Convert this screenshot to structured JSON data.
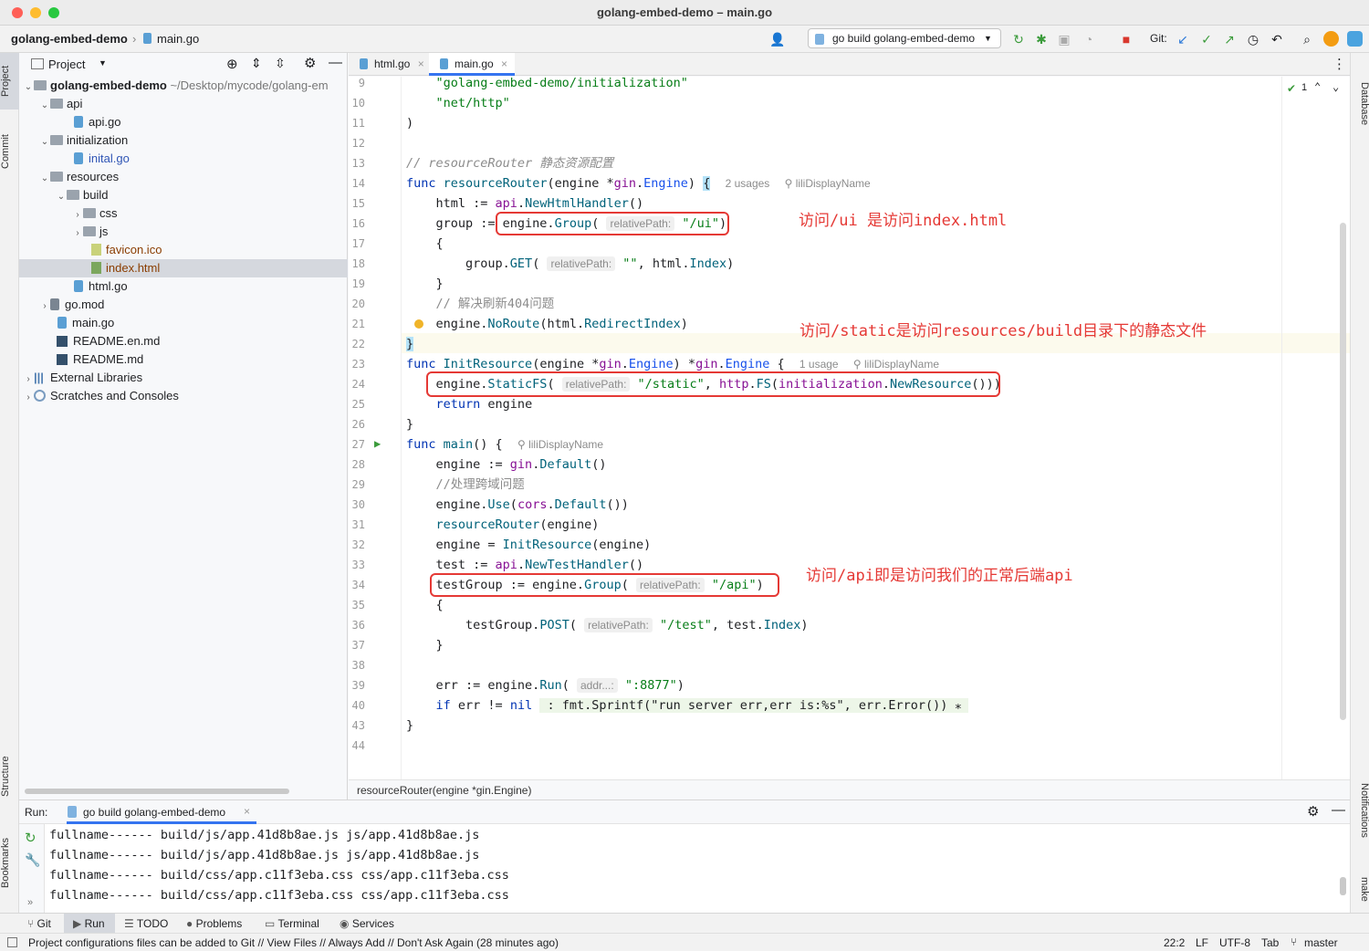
{
  "window": {
    "title": "golang-embed-demo – main.go"
  },
  "nav": {
    "project": "golang-embed-demo",
    "file": "main.go",
    "run_config": "go build golang-embed-demo",
    "git_label": "Git:"
  },
  "left_stripe": {
    "project": "Project",
    "commit": "Commit",
    "structure": "Structure",
    "bookmarks": "Bookmarks"
  },
  "right_stripe": {
    "database": "Database",
    "notifications": "Notifications",
    "make": "make"
  },
  "project_panel": {
    "title": "Project",
    "tree": [
      {
        "name": "golang-embed-demo",
        "extra": "~/Desktop/mycode/golang-em"
      },
      {
        "name": "api"
      },
      {
        "name": "api.go"
      },
      {
        "name": "initialization"
      },
      {
        "name": "inital.go"
      },
      {
        "name": "resources"
      },
      {
        "name": "build"
      },
      {
        "name": "css"
      },
      {
        "name": "js"
      },
      {
        "name": "favicon.ico"
      },
      {
        "name": "index.html"
      },
      {
        "name": "html.go"
      },
      {
        "name": "go.mod"
      },
      {
        "name": "main.go"
      },
      {
        "name": "README.en.md"
      },
      {
        "name": "README.md"
      },
      {
        "name": "External Libraries"
      },
      {
        "name": "Scratches and Consoles"
      }
    ]
  },
  "tabs": [
    "html.go",
    "main.go"
  ],
  "editor": {
    "inspection_count": "1",
    "line_numbers": [
      "9",
      "10",
      "11",
      "12",
      "13",
      "14",
      "15",
      "16",
      "17",
      "18",
      "19",
      "20",
      "21",
      "22",
      "23",
      "24",
      "25",
      "26",
      "27",
      "28",
      "29",
      "30",
      "31",
      "32",
      "33",
      "34",
      "35",
      "36",
      "37",
      "38",
      "39",
      "40",
      "43",
      "44"
    ],
    "hints": {
      "usages2": "2 usages",
      "author": "liliDisplayName",
      "usage1": "1 usage",
      "relativePath": "relativePath:",
      "addr": "addr...:"
    },
    "annotations": {
      "ui": "访问/ui 是访问index.html",
      "static": "访问/static是访问resources/build目录下的静态文件",
      "api": "访问/api即是访问我们的正常后端api"
    }
  },
  "breadcrumb": "resourceRouter(engine *gin.Engine)",
  "run": {
    "label": "Run:",
    "tab": "go build golang-embed-demo",
    "output": [
      "fullname------ build/js/app.41d8b8ae.js js/app.41d8b8ae.js",
      "fullname------ build/js/app.41d8b8ae.js js/app.41d8b8ae.js",
      "fullname------ build/css/app.c11f3eba.css css/app.c11f3eba.css",
      "fullname------ build/css/app.c11f3eba.css css/app.c11f3eba.css"
    ]
  },
  "toolwindows": [
    "Git",
    "Run",
    "TODO",
    "Problems",
    "Terminal",
    "Services"
  ],
  "status": {
    "message": "Project configurations files can be added to Git // View Files // Always Add // Don't Ask Again (28 minutes ago)",
    "position": "22:2",
    "line_sep": "LF",
    "encoding": "UTF-8",
    "indent": "Tab",
    "branch": "master"
  }
}
